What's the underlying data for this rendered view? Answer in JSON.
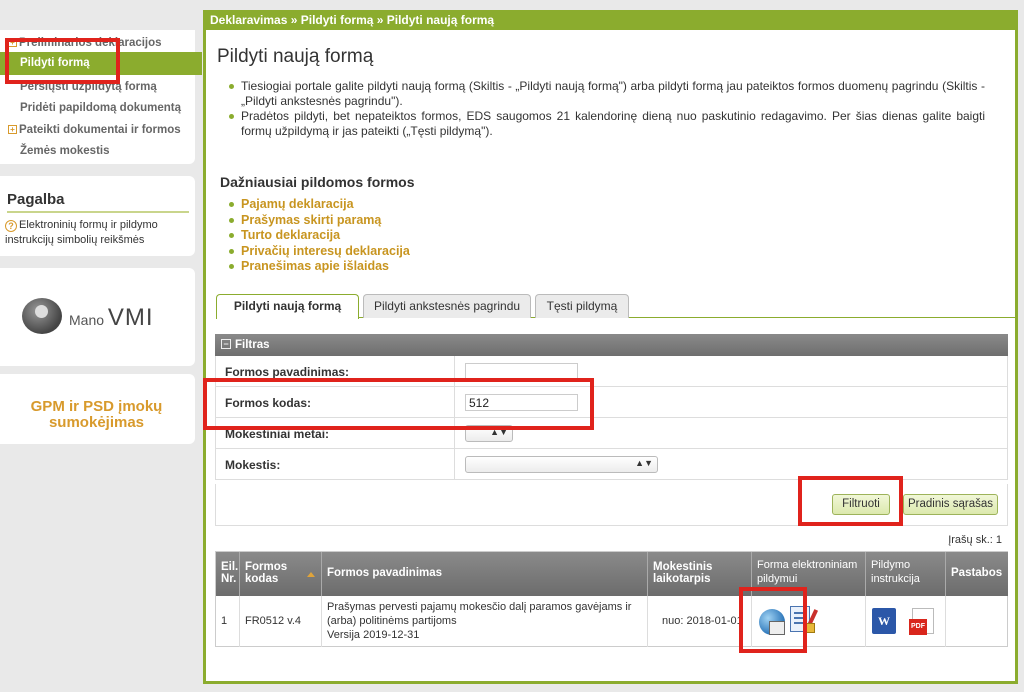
{
  "sidebar": {
    "nav": {
      "item_declarations": "Preliminarios deklaracijos",
      "item_fill_form": "Pildyti formą",
      "item_send_form": "Persiųsti užpildytą formą",
      "item_attach_doc": "Pridėti papildomą dokumentą",
      "item_submitted": "Pateikti dokumentai ir formos",
      "item_land_tax": "Žemės mokestis"
    },
    "help": {
      "title": "Pagalba",
      "text": "Elektroninių formų ir pildymo instrukcijų simbolių reikšmės"
    },
    "mano": {
      "prefix": "Mano",
      "suffix": "VMI"
    },
    "gpm": {
      "line1": "GPM ir PSD įmokų",
      "line2": "sumokėjimas"
    }
  },
  "main": {
    "breadcrumb": "Deklaravimas » Pildyti formą » Pildyti naują formą",
    "title": "Pildyti naują formą",
    "info": [
      "Tiesiogiai portale galite pildyti naują formą (Skiltis - „Pildyti naują formą\") arba pildyti formą jau pateiktos formos duomenų pagrindu (Skiltis - „Pildyti ankstesnės pagrindu\").",
      "Pradėtos pildyti, bet nepateiktos formos, EDS saugomos 21 kalendorinę dieną nuo paskutinio redagavimo. Per šias dienas galite baigti formų užpildymą ir jas pateikti („Tęsti pildymą\")."
    ],
    "frequent_title": "Dažniausiai pildomos formos",
    "frequent": [
      "Pajamų deklaracija",
      "Prašymas skirti paramą",
      "Turto deklaracija",
      "Privačių interesų deklaracija",
      "Pranešimas apie išlaidas"
    ],
    "tabs": {
      "new": "Pildyti naują formą",
      "previous": "Pildyti ankstesnės pagrindu",
      "continue": "Tęsti pildymą"
    },
    "filter": {
      "title": "Filtras",
      "name_label": "Formos pavadinimas:",
      "name_value": "",
      "code_label": "Formos kodas:",
      "code_value": "512",
      "year_label": "Mokestiniai metai:",
      "tax_label": "Mokestis:",
      "filter_button": "Filtruoti",
      "reset_button": "Pradinis sąrašas"
    },
    "count": "Įrašų sk.: 1",
    "table": {
      "headers": {
        "nr": [
          "Eil.",
          "Nr."
        ],
        "code": [
          "Formos",
          "kodas"
        ],
        "name": "Formos pavadinimas",
        "period": [
          "Mokestinis",
          "laikotarpis"
        ],
        "electronic": [
          "Forma elektroniniam",
          "pildymui"
        ],
        "instruction": [
          "Pildymo",
          "instrukcija"
        ],
        "notes": "Pastabos"
      },
      "row": {
        "nr": "1",
        "code": "FR0512 v.4",
        "name_line1": "Prašymas pervesti pajamų mokesčio dalį paramos gavėjams ir",
        "name_line2": "(arba) politinėms partijoms",
        "version": "Versija 2019-12-31",
        "period": "nuo: 2018-01-01"
      }
    }
  }
}
